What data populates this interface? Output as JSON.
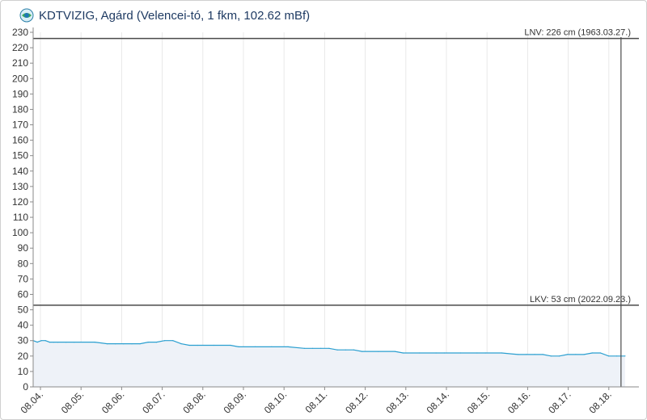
{
  "header": {
    "title": "KDTVIZIG, Agárd (Velencei-tó, 1 fkm, 102.62 mBf)",
    "logo_icon": "water-drop-logo-icon"
  },
  "colors": {
    "series": "#2a9fd0",
    "area_fill": "#eef2f8",
    "reference_line": "#4a4a4a",
    "grid": "#e8e8e8",
    "title": "#1f3b63"
  },
  "chart_data": {
    "type": "area",
    "title": "KDTVIZIG, Agárd (Velencei-tó, 1 fkm, 102.62 mBf)",
    "xlabel": "",
    "ylabel": "",
    "ylim": [
      0,
      230
    ],
    "yticks": [
      0,
      10,
      20,
      30,
      40,
      50,
      60,
      70,
      80,
      90,
      100,
      110,
      120,
      130,
      140,
      150,
      160,
      170,
      180,
      190,
      200,
      210,
      220,
      230
    ],
    "xticks": [
      "08.04.",
      "08.05.",
      "08.06.",
      "08.07.",
      "08.08.",
      "08.09.",
      "08.10.",
      "08.11.",
      "08.12.",
      "08.13.",
      "08.14.",
      "08.15.",
      "08.16.",
      "08.17.",
      "08.18."
    ],
    "grid": "vertical",
    "series": [
      {
        "x": [
          0,
          0.1,
          0.2,
          0.3,
          0.4,
          0.5,
          0.6,
          0.8,
          1.0,
          1.5,
          1.8,
          2.0,
          2.2,
          2.4,
          2.6,
          2.8,
          3.0,
          3.2,
          3.4,
          3.6,
          3.8,
          4.0,
          4.4,
          4.8,
          5.0,
          5.4,
          5.8,
          6.2,
          6.6,
          6.8,
          7.0,
          7.2,
          7.4,
          7.6,
          7.8,
          8.0,
          8.4,
          8.8,
          9.0,
          9.4,
          9.8,
          10.0,
          10.4,
          10.8,
          11.0,
          11.4,
          11.8,
          12.0,
          12.2,
          12.4,
          12.6,
          12.8,
          13.0,
          13.2,
          13.4,
          13.6,
          13.8,
          14.0,
          14.2,
          14.4
        ],
        "values": [
          30,
          29,
          30,
          30,
          29,
          29,
          29,
          29,
          29,
          29,
          28,
          28,
          28,
          28,
          28,
          29,
          29,
          30,
          30,
          28,
          27,
          27,
          27,
          27,
          26,
          26,
          26,
          26,
          25,
          25,
          25,
          25,
          24,
          24,
          24,
          23,
          23,
          23,
          22,
          22,
          22,
          22,
          22,
          22,
          22,
          22,
          21,
          21,
          21,
          21,
          20,
          20,
          21,
          21,
          21,
          22,
          22,
          20,
          20,
          20
        ]
      }
    ],
    "reference_lines": [
      {
        "orientation": "horizontal",
        "value": 226,
        "label": "LNV: 226 cm (1963.03.27.)"
      },
      {
        "orientation": "horizontal",
        "value": 53,
        "label": "LKV: 53 cm (2022.09.23.)"
      },
      {
        "orientation": "vertical",
        "x": 14.3
      }
    ]
  }
}
